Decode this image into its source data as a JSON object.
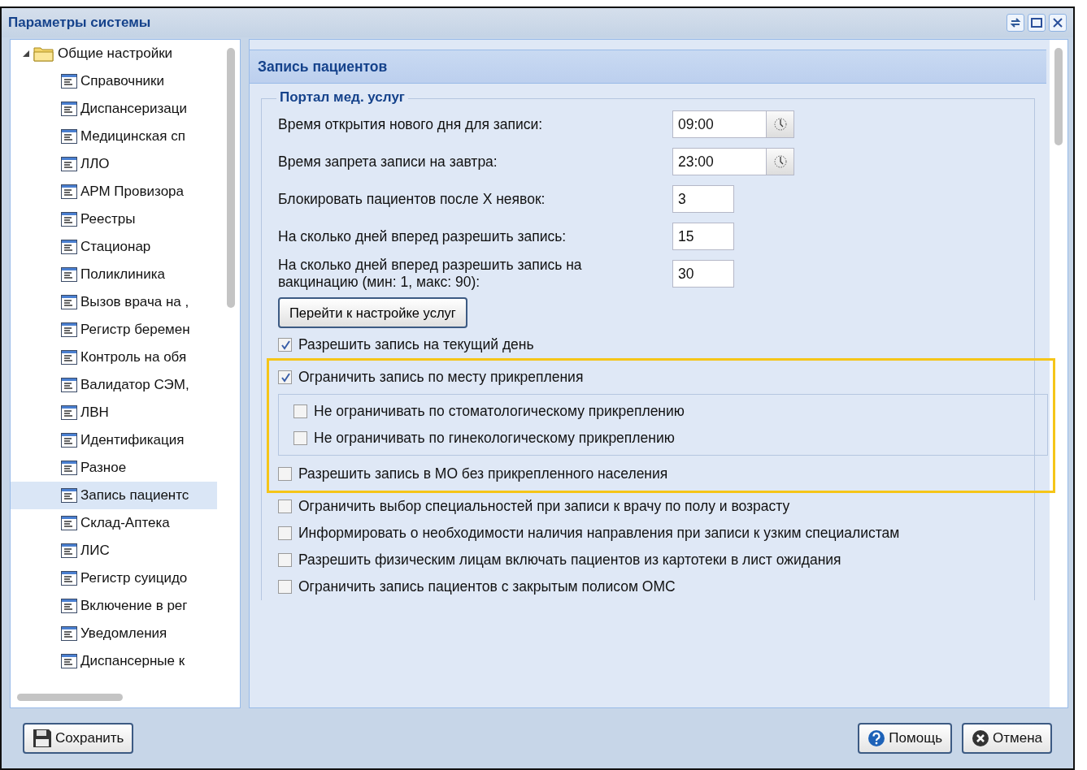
{
  "window": {
    "title": "Параметры системы"
  },
  "tree": {
    "label": "Общие настройки",
    "expanded": true,
    "children": [
      {
        "label": "Справочники",
        "selected": false
      },
      {
        "label": "Диспансеризаци",
        "selected": false
      },
      {
        "label": "Медицинская сп",
        "selected": false
      },
      {
        "label": "ЛЛО",
        "selected": false
      },
      {
        "label": "АРМ Провизора",
        "selected": false
      },
      {
        "label": "Реестры",
        "selected": false
      },
      {
        "label": "Стационар",
        "selected": false
      },
      {
        "label": "Поликлиника",
        "selected": false
      },
      {
        "label": "Вызов врача на ,",
        "selected": false
      },
      {
        "label": "Регистр беремен",
        "selected": false
      },
      {
        "label": "Контроль на обя",
        "selected": false
      },
      {
        "label": "Валидатор СЭМ,",
        "selected": false
      },
      {
        "label": "ЛВН",
        "selected": false
      },
      {
        "label": "Идентификация",
        "selected": false
      },
      {
        "label": "Разное",
        "selected": false
      },
      {
        "label": "Запись пациентс",
        "selected": true
      },
      {
        "label": "Склад-Аптека",
        "selected": false
      },
      {
        "label": "ЛИС",
        "selected": false
      },
      {
        "label": "Регистр суицидо",
        "selected": false
      },
      {
        "label": "Включение в рег",
        "selected": false
      },
      {
        "label": "Уведомления",
        "selected": false
      },
      {
        "label": "Диспансерные к",
        "selected": false
      }
    ]
  },
  "panel": {
    "header": "Запись пациентов",
    "legend": "Портал мед. услуг",
    "fields": [
      {
        "kind": "time",
        "label": "Время открытия нового дня для записи:",
        "value": "09:00"
      },
      {
        "kind": "time",
        "label": "Время запрета записи на завтра:",
        "value": "23:00"
      },
      {
        "kind": "number",
        "label": "Блокировать пациентов после X неявок:",
        "value": "3"
      },
      {
        "kind": "number",
        "label": "На сколько дней вперед разрешить запись:",
        "value": "15"
      },
      {
        "kind": "number",
        "label": "На сколько дней вперед разрешить запись на вакцинацию (мин: 1, макс: 90):",
        "value": "30"
      }
    ],
    "button": "Перейти к настройке услуг",
    "options": [
      {
        "kind": "checkbox",
        "label": "Разрешить запись на текущий день",
        "checked": true
      },
      {
        "kind": "highlight",
        "items": [
          {
            "label": "Ограничить запись по месту прикрепления",
            "checked": true,
            "children": [
              {
                "label": "Не ограничивать по стоматологическому прикреплению",
                "checked": false
              },
              {
                "label": "Не ограничивать по гинекологическому прикреплению",
                "checked": false
              }
            ]
          },
          {
            "label": "Разрешить запись в МО без прикрепленного населения",
            "checked": false
          }
        ]
      },
      {
        "kind": "checkbox",
        "label": "Ограничить выбор специальностей при записи к врачу по полу и возрасту",
        "checked": false
      },
      {
        "kind": "checkbox",
        "label": "Информировать о необходимости наличия направления при записи к узким специалистам",
        "checked": false
      },
      {
        "kind": "checkbox",
        "label": "Разрешить физическим лицам включать пациентов из картотеки в лист ожидания",
        "checked": false
      },
      {
        "kind": "checkbox",
        "label": "Ограничить запись пациентов с закрытым полисом ОМС",
        "checked": false
      }
    ]
  },
  "footer": {
    "save": "Сохранить",
    "help": "Помощь",
    "cancel": "Отмена"
  }
}
